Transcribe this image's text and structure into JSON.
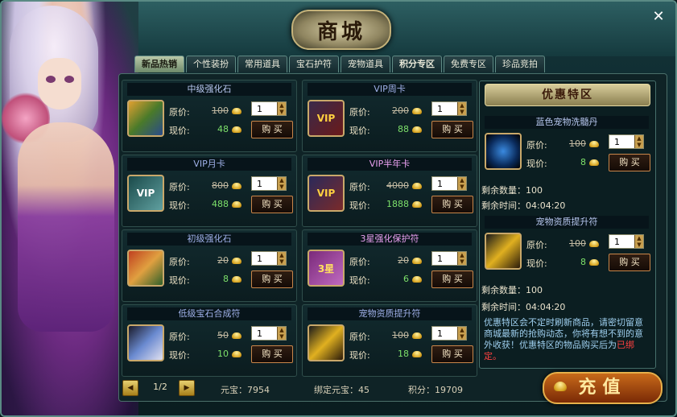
{
  "window": {
    "title": "商城",
    "close_glyph": "✕"
  },
  "tabs": [
    {
      "label": "新品热销",
      "active": true
    },
    {
      "label": "个性装扮",
      "active": false
    },
    {
      "label": "常用道具",
      "active": false
    },
    {
      "label": "宝石护符",
      "active": false
    },
    {
      "label": "宠物道具",
      "active": false
    },
    {
      "label": "积分专区",
      "active": false
    },
    {
      "label": "免费专区",
      "active": false
    },
    {
      "label": "珍品竞拍",
      "active": false
    }
  ],
  "labels": {
    "orig": "原价:",
    "now": "现价:",
    "buy": "购 买"
  },
  "items": [
    {
      "name": "中级强化石",
      "orig": "100",
      "now": "48",
      "qty": "1",
      "icon": "enhance-stone-icon"
    },
    {
      "name": "VIP周卡",
      "orig": "200",
      "now": "88",
      "qty": "1",
      "icon": "vip-card-icon",
      "icon_text": "VIP"
    },
    {
      "name": "VIP月卡",
      "orig": "800",
      "now": "488",
      "qty": "1",
      "icon": "vip-card-icon",
      "icon_text": "VIP"
    },
    {
      "name": "VIP半年卡",
      "orig": "4000",
      "now": "1888",
      "qty": "1",
      "icon": "vip-card-icon",
      "icon_text": "VIP"
    },
    {
      "name": "初级强化石",
      "orig": "20",
      "now": "8",
      "qty": "1",
      "icon": "enhance-stone-icon"
    },
    {
      "name": "3星强化保护符",
      "orig": "20",
      "now": "6",
      "qty": "1",
      "icon": "protect-charm-icon",
      "icon_text": "3星"
    },
    {
      "name": "低级宝石合成符",
      "orig": "50",
      "now": "10",
      "qty": "1",
      "icon": "gem-scroll-icon"
    },
    {
      "name": "宠物资质提升符",
      "orig": "100",
      "now": "18",
      "qty": "1",
      "icon": "pet-talisman-icon"
    }
  ],
  "special": {
    "title": "优惠特区",
    "items": [
      {
        "name": "蓝色宠物洗髓丹",
        "orig": "100",
        "now": "8",
        "qty": "1",
        "icon": "blue-pill-icon",
        "remain_count": "剩余数量：100",
        "remain_time": "剩余时间：04:04:20"
      },
      {
        "name": "宠物资质提升符",
        "orig": "100",
        "now": "8",
        "qty": "1",
        "icon": "pet-talisman-icon",
        "remain_count": "剩余数量：100",
        "remain_time": "剩余时间：04:04:20"
      }
    ],
    "note": "优惠特区会不定时刷新商品，请密切留意商城最新的抢购动态，你将有想不到的意外收获！优惠特区的物品购买后为",
    "note_red": "已绑定。"
  },
  "footer": {
    "page": "1/2",
    "yuanbao": "元宝：7954",
    "bound": "绑定元宝：45",
    "points": "积分：19709",
    "recharge": "充值"
  }
}
